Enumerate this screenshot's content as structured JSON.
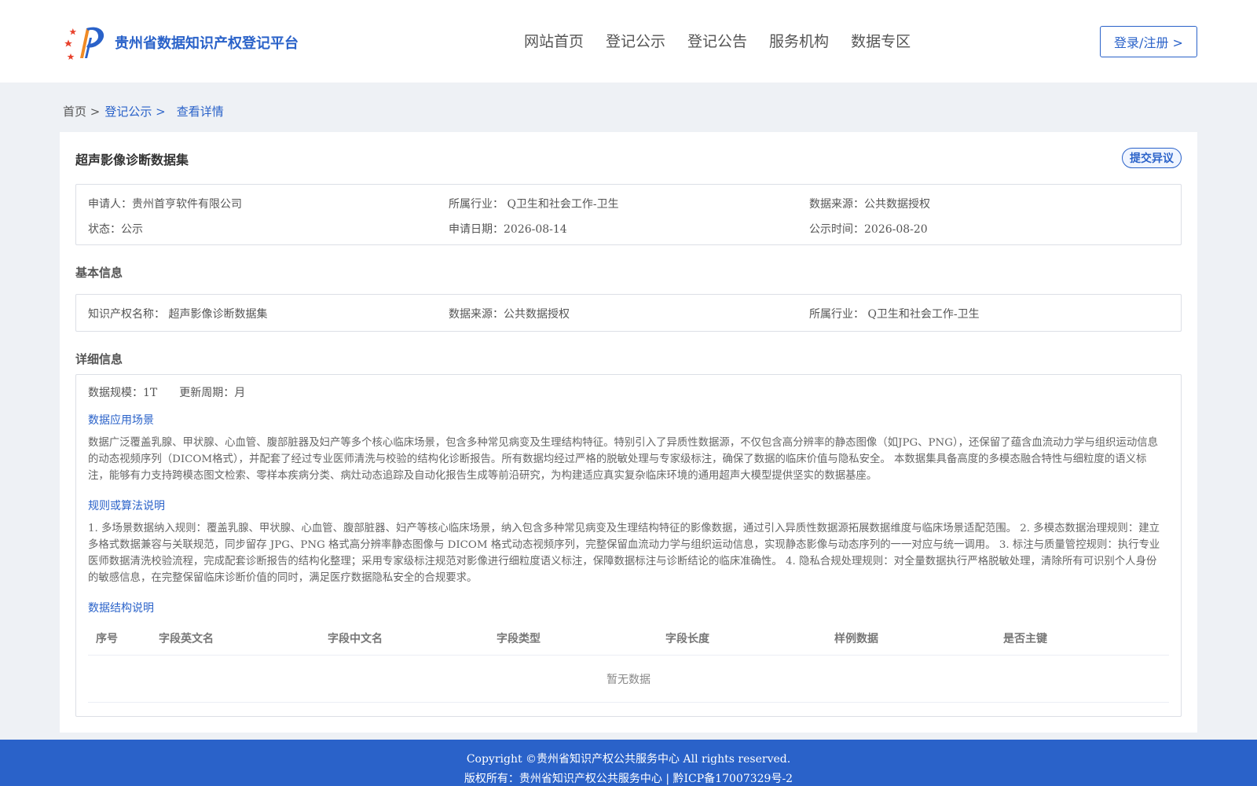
{
  "header": {
    "brand_name": "贵州省数据知识产权登记平台",
    "nav": [
      "网站首页",
      "登记公示",
      "登记公告",
      "服务机构",
      "数据专区"
    ],
    "login_label": "登录/注册 >"
  },
  "breadcrumb": {
    "home": "首页 >",
    "list": "登记公示 >",
    "current": "查看详情"
  },
  "record": {
    "title": "超声影像诊断数据集",
    "objection_label": "提交异议",
    "summary_row1": [
      "申请人：贵州首亨软件有限公司",
      "所属行业： Q卫生和社会工作-卫生",
      "数据来源：公共数据授权"
    ],
    "summary_row2": [
      "状态：公示",
      "申请日期：2026-08-14",
      "公示时间：2026-08-20"
    ]
  },
  "basic": {
    "section_title": "基本信息",
    "row": [
      "知识产权名称： 超声影像诊断数据集",
      "数据来源：公共数据授权",
      "所属行业： Q卫生和社会工作-卫生"
    ]
  },
  "detail": {
    "section_title": "详细信息",
    "scale": "数据规模：1T",
    "cycle": "更新周期：月",
    "scenario_title": "数据应用场景",
    "scenario_text": "数据广泛覆盖乳腺、甲状腺、心血管、腹部脏器及妇产等多个核心临床场景，包含多种常见病变及生理结构特征。特别引入了异质性数据源，不仅包含高分辨率的静态图像（如JPG、PNG），还保留了蕴含血流动力学与组织运动信息的动态视频序列（DICOM格式），并配套了经过专业医师清洗与校验的结构化诊断报告。所有数据均经过严格的脱敏处理与专家级标注，确保了数据的临床价值与隐私安全。 本数据集具备高度的多模态融合特性与细粒度的语义标注，能够有力支持跨模态图文检索、零样本疾病分类、病灶动态追踪及自动化报告生成等前沿研究，为构建适应真实复杂临床环境的通用超声大模型提供坚实的数据基座。",
    "rules_title": "规则或算法说明",
    "rules_text": "1. 多场景数据纳入规则：覆盖乳腺、甲状腺、心血管、腹部脏器、妇产等核心临床场景，纳入包含多种常见病变及生理结构特征的影像数据，通过引入异质性数据源拓展数据维度与临床场景适配范围。 2. 多模态数据治理规则：建立多格式数据兼容与关联规范，同步留存 JPG、PNG 格式高分辨率静态图像与 DICOM 格式动态视频序列，完整保留血流动力学与组织运动信息，实现静态影像与动态序列的一一对应与统一调用。 3. 标注与质量管控规则：执行专业医师数据清洗校验流程，完成配套诊断报告的结构化整理；采用专家级标注规范对影像进行细粒度语义标注，保障数据标注与诊断结论的临床准确性。 4. 隐私合规处理规则：对全量数据执行严格脱敏处理，清除所有可识别个人身份的敏感信息，在完整保留临床诊断价值的同时，满足医疗数据隐私安全的合规要求。",
    "structure_title": "数据结构说明",
    "table_headers": [
      "序号",
      "字段英文名",
      "字段中文名",
      "字段类型",
      "字段长度",
      "样例数据",
      "是否主键"
    ],
    "empty_text": "暂无数据"
  },
  "footer": {
    "line1": "Copyright ©贵州省知识产权公共服务中心 All rights reserved.",
    "line2": "版权所有：贵州省知识产权公共服务中心 | 黔ICP备17007329号-2"
  },
  "colors": {
    "accent": "#2a62c9",
    "logo_red": "#e8412c",
    "logo_orange": "#f08a24"
  }
}
